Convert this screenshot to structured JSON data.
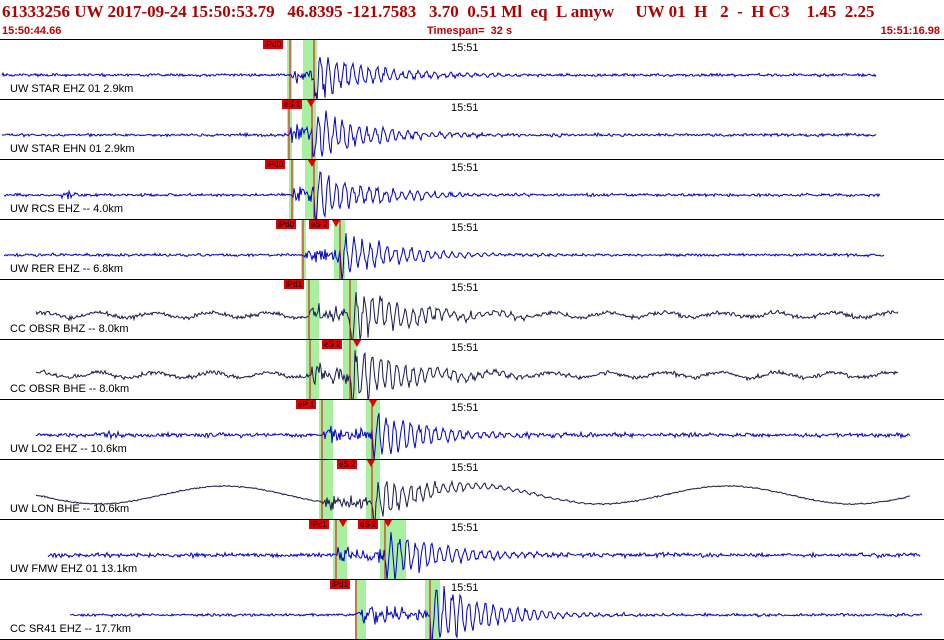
{
  "header": {
    "line1": "61333256 UW 2017-09-24 15:50:53.79   46.8395 -121.7583   3.70  0.51 Ml  eq  L amyw     UW 01  H   2  -  H C3    1.45  2.25",
    "start_time": "15:50:44.66",
    "timespan": "Timespan=  32 s",
    "end_time": "15:51:16.98"
  },
  "colors": {
    "header_text": "#b00000",
    "trace_blue": "#0000c8",
    "trace_dark": "#1a1a50",
    "pick_red": "#e00000",
    "window_green": "#a8f0a0"
  },
  "icons": {
    "pick_marker": "red-flag-triangle"
  },
  "traces": [
    {
      "label": "UW STAR EHZ 01 2.9km",
      "minute": "15:51",
      "color": "blue",
      "picks": [
        {
          "text": "iPd0"
        }
      ]
    },
    {
      "label": "UW STAR EHN 01 2.9km",
      "minute": "15:51",
      "color": "blue",
      "picks": [
        {
          "text": "eS 1"
        }
      ]
    },
    {
      "label": "UW RCS EHZ -- 4.0km",
      "minute": "15:51",
      "color": "blue",
      "picks": [
        {
          "text": "iPd0"
        }
      ]
    },
    {
      "label": "UW RER EHZ -- 6.8km",
      "minute": "15:51",
      "color": "blue",
      "picks": [
        {
          "text": "iPd0"
        },
        {
          "text": "eS 2"
        }
      ]
    },
    {
      "label": "CC OBSR BHZ -- 8.0km",
      "minute": "15:51",
      "color": "dark",
      "picks": [
        {
          "text": "iPd1"
        }
      ]
    },
    {
      "label": "CC OBSR BHE -- 8.0km",
      "minute": "15:51",
      "color": "dark",
      "picks": [
        {
          "text": "eS 2"
        }
      ]
    },
    {
      "label": "UW LO2 EHZ -- 10.6km",
      "minute": "15:51",
      "color": "blue",
      "picks": [
        {
          "text": "eP 1"
        }
      ]
    },
    {
      "label": "UW LON BHE -- 10.6km",
      "minute": "15:51",
      "color": "dark",
      "picks": [
        {
          "text": "eS 2"
        }
      ]
    },
    {
      "label": "UW FMW EHZ 01 13.1km",
      "minute": "15:51",
      "color": "blue",
      "picks": [
        {
          "text": "iPc1"
        },
        {
          "text": "eS 2"
        }
      ]
    },
    {
      "label": "CC SR41 EHZ -- 17.7km",
      "minute": "15:51",
      "color": "blue",
      "picks": [
        {
          "text": "iPd1"
        }
      ]
    }
  ]
}
